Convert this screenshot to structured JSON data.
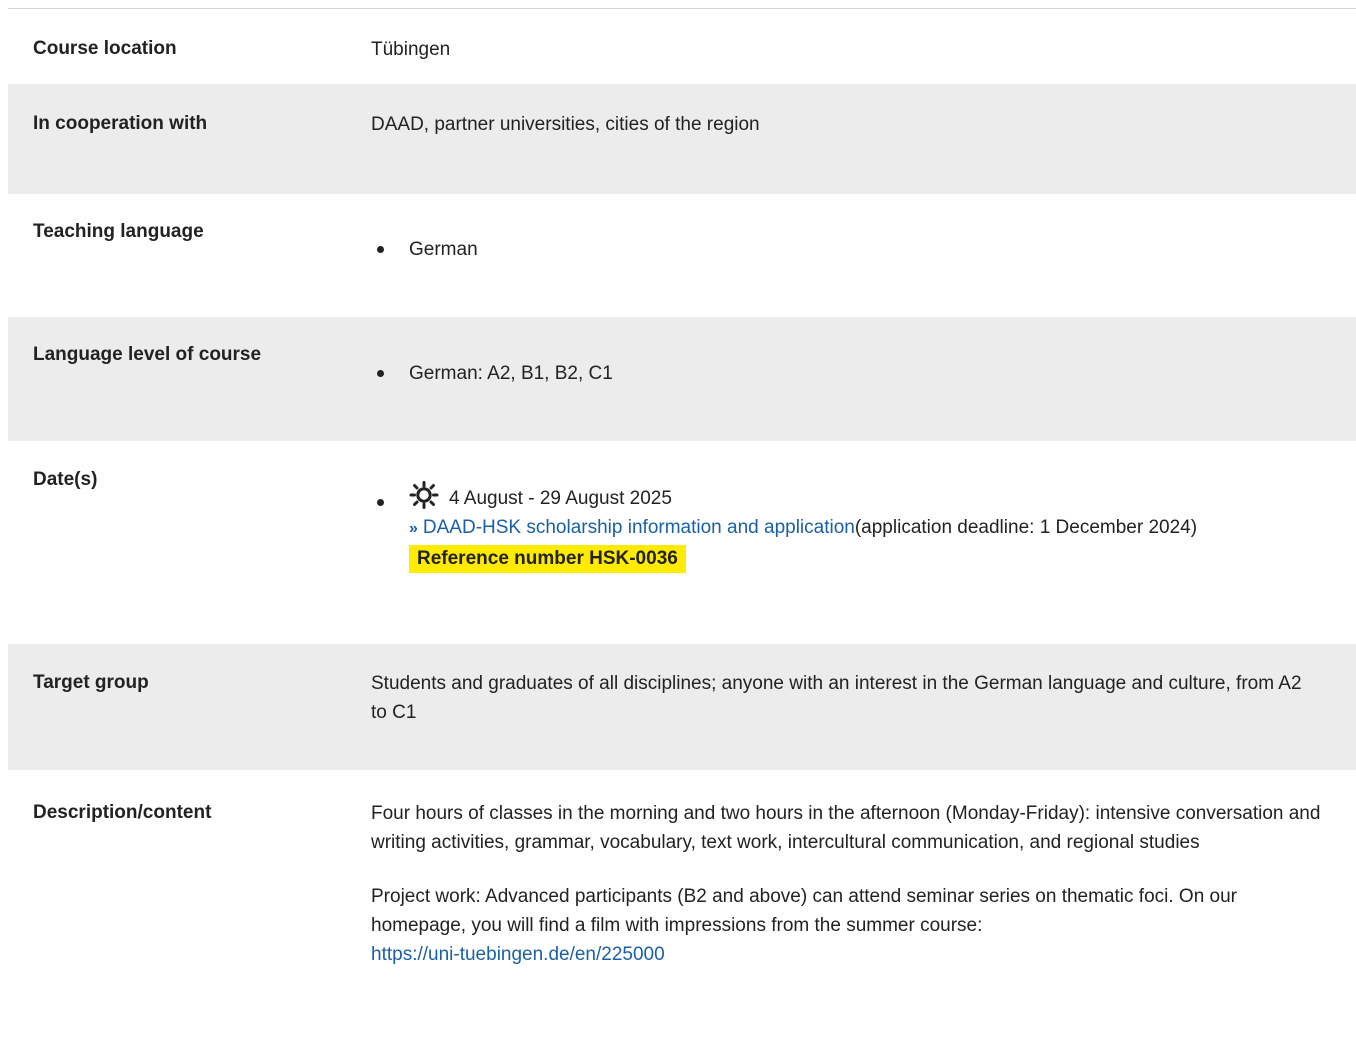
{
  "rows": {
    "location": {
      "label": "Course location",
      "value": "Tübingen"
    },
    "cooperation": {
      "label": "In cooperation with",
      "value": "DAAD, partner universities, cities of the region"
    },
    "teaching_language": {
      "label": "Teaching language",
      "items": [
        "German"
      ]
    },
    "language_level": {
      "label": "Language level of course",
      "items": [
        "German: A2, B1, B2, C1"
      ]
    },
    "dates": {
      "label": "Date(s)",
      "date": "4 August - 29 August 2025",
      "icon": "sun-icon",
      "link_text": "DAAD-HSK scholarship information and application",
      "deadline_text": "(application deadline: 1 December 2024)",
      "reference": "Reference number HSK-0036"
    },
    "target_group": {
      "label": "Target group",
      "value": "Students and graduates of all disciplines; anyone with an interest in the German language and culture, from A2 to C1"
    },
    "description": {
      "label": "Description/content",
      "paragraph1": "Four hours of classes in the morning and two hours in the afternoon (Monday-Friday): intensive conversation and writing activities, grammar, vocabulary, text work, intercultural communication, and regional studies",
      "paragraph2": "Project work: Advanced participants (B2 and above) can attend seminar series on thematic foci. On our homepage, you will find a film with impressions from the summer course:",
      "url_text": "https://uni-tuebingen.de/en/225000"
    }
  },
  "colors": {
    "row_alt_bg": "#ececec",
    "link": "#1a5fa8",
    "highlight": "#ffeb00"
  }
}
